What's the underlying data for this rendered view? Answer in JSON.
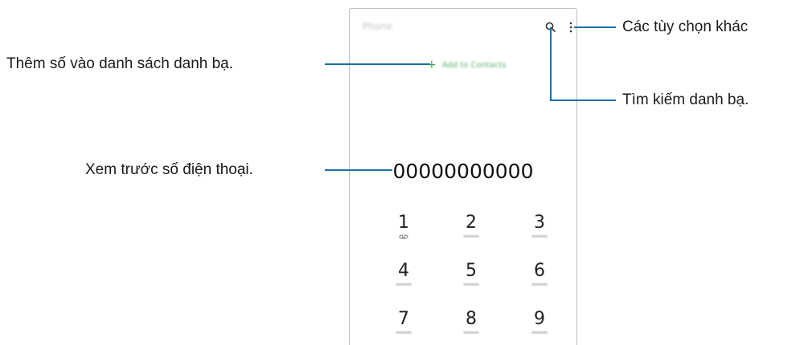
{
  "phone": {
    "app_title": "Phone",
    "add_contact_label": "Add to Contacts",
    "add_icon_glyph": "+",
    "number": "00000000000",
    "keypad": [
      {
        "digit": "1",
        "sub": "voicemail-icon"
      },
      {
        "digit": "2"
      },
      {
        "digit": "3"
      },
      {
        "digit": "4"
      },
      {
        "digit": "5"
      },
      {
        "digit": "6"
      },
      {
        "digit": "7"
      },
      {
        "digit": "8"
      },
      {
        "digit": "9"
      }
    ],
    "accent_color": "#3aa44a"
  },
  "callouts": {
    "more_options": "Các tùy chọn khác",
    "search_contacts": "Tìm kiếm danh bạ.",
    "add_to_contacts": "Thêm số vào danh sách danh bạ.",
    "preview_number": "Xem trước số điện thoại."
  },
  "leader_line_color": "#1f6fa6"
}
